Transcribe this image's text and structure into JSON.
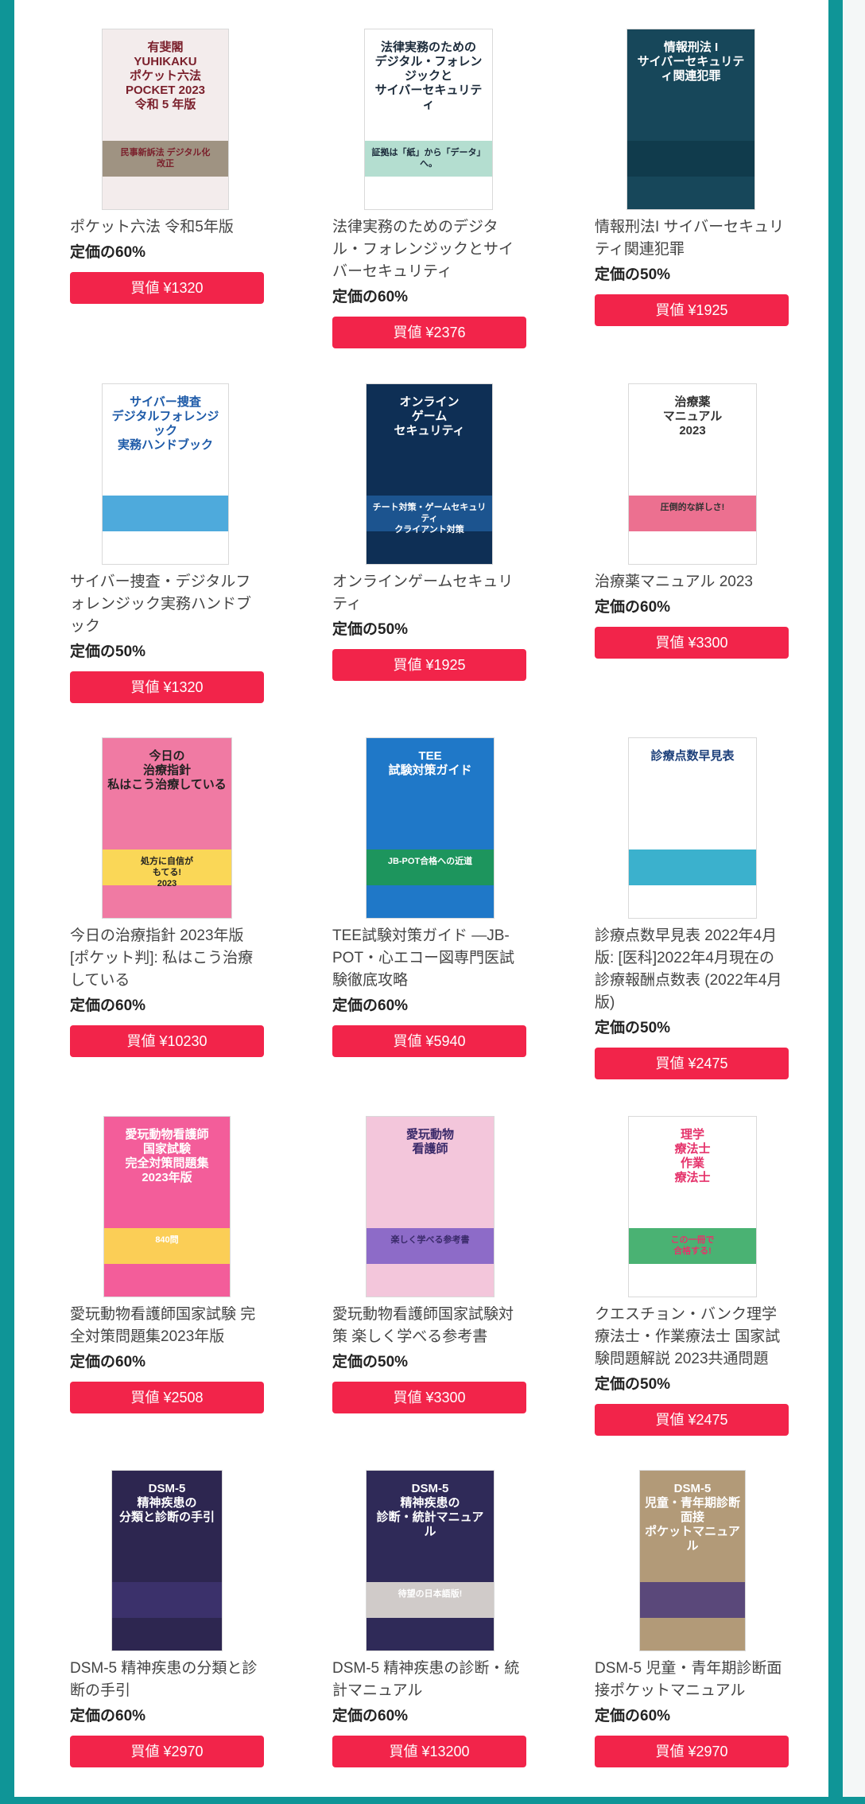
{
  "products": [
    {
      "title": "ポケット六法 令和5年版",
      "rate": "定価の60%",
      "price": "買値 ¥1320",
      "cover": {
        "bg": "#f3ecec",
        "fg": "#7a1f2b",
        "accent": "#8f8470",
        "icon": "book-pocket-roppo-cover-icon",
        "lines": "有斐閣\nYUHIKAKU\nポケット六法\nPOCKET 2023\n令和 5 年版",
        "sub": "民事新訴法 デジタル化\n改正"
      }
    },
    {
      "title": "法律実務のためのデジタル・フォレンジックとサイバーセキュリティ",
      "rate": "定価の60%",
      "price": "買値 ¥2376",
      "cover": {
        "bg": "#ffffff",
        "fg": "#1b2a3a",
        "accent": "#a7d8c8",
        "icon": "book-digital-forensics-cover-icon",
        "lines": "法律実務のための\nデジタル・フォレンジックと\nサイバーセキュリティ",
        "sub": "証拠は「紙」から「データ」へ。"
      }
    },
    {
      "title": "情報刑法I サイバーセキュリティ関連犯罪",
      "rate": "定価の50%",
      "price": "買値 ¥1925",
      "cover": {
        "bg": "#17475a",
        "fg": "#ffffff",
        "accent": "#0f3a4a",
        "icon": "book-joho-keiho-cover-icon",
        "lines": "情報刑法 I\nサイバーセキュリティ関連犯罪",
        "sub": ""
      }
    },
    {
      "title": "サイバー捜査・デジタルフォレンジック実務ハンドブック",
      "rate": "定価の50%",
      "price": "買値 ¥1320",
      "cover": {
        "bg": "#ffffff",
        "fg": "#1d5aa8",
        "accent": "#2f9bd6",
        "icon": "book-cyber-sousa-cover-icon",
        "lines": "サイバー捜査\nデジタルフォレンジック\n実務ハンドブック",
        "sub": ""
      }
    },
    {
      "title": "オンラインゲームセキュリティ",
      "rate": "定価の50%",
      "price": "買値 ¥1925",
      "cover": {
        "bg": "#0e2f55",
        "fg": "#ffffff",
        "accent": "#1f5b9a",
        "icon": "book-online-game-security-cover-icon",
        "lines": "オンライン\nゲーム\nセキュリティ",
        "sub": "チート対策・ゲームセキュリティ\nクライアント対策"
      }
    },
    {
      "title": "治療薬マニュアル 2023",
      "rate": "定価の60%",
      "price": "買値 ¥3300",
      "cover": {
        "bg": "#ffffff",
        "fg": "#333333",
        "accent": "#e9577c",
        "icon": "book-chiryoyaku-cover-icon",
        "lines": "治療薬\nマニュアル\n2023",
        "sub": "圧倒的な詳しさ!"
      }
    },
    {
      "title": "今日の治療指針 2023年版 [ポケット判]: 私はこう治療している",
      "rate": "定価の60%",
      "price": "買値 ¥10230",
      "cover": {
        "bg": "#f07aa3",
        "fg": "#222222",
        "accent": "#fbe74a",
        "icon": "book-kyou-no-chiryou-cover-icon",
        "lines": "今日の\n治療指針\n私はこう治療している",
        "sub": "処方に自信が\nもてる!\n2023"
      }
    },
    {
      "title": "TEE試験対策ガイド —JB-POT・心エコー図専門医試験徹底攻略",
      "rate": "定価の60%",
      "price": "買値 ¥5940",
      "cover": {
        "bg": "#1f78c8",
        "fg": "#ffffff",
        "accent": "#1d9a4a",
        "icon": "book-tee-guide-cover-icon",
        "lines": "TEE\n試験対策ガイド",
        "sub": "JB-POT合格への近道"
      }
    },
    {
      "title": "診療点数早見表 2022年4月版: [医科]2022年4月現在の診療報酬点数表 (2022年4月版)",
      "rate": "定価の50%",
      "price": "買値 ¥2475",
      "cover": {
        "bg": "#ffffff",
        "fg": "#1c3f7a",
        "accent": "#19a3c4",
        "icon": "book-shinryo-tensu-cover-icon",
        "lines": "診療点数早見表",
        "sub": ""
      }
    },
    {
      "title": "愛玩動物看護師国家試験 完全対策問題集2023年版",
      "rate": "定価の60%",
      "price": "買値 ¥2508",
      "cover": {
        "bg": "#f35d9a",
        "fg": "#ffffff",
        "accent": "#fbe24a",
        "icon": "book-aigan-mondaishu-cover-icon",
        "lines": "愛玩動物看護師\n国家試験\n完全対策問題集\n2023年版",
        "sub": "840問"
      }
    },
    {
      "title": "愛玩動物看護師国家試験対策 楽しく学べる参考書",
      "rate": "定価の50%",
      "price": "買値 ¥3300",
      "cover": {
        "bg": "#f3c6db",
        "fg": "#3a2a6a",
        "accent": "#7a5bc4",
        "icon": "book-aigan-sankousho-cover-icon",
        "lines": "愛玩動物\n看護師",
        "sub": "楽しく学べる参考書"
      }
    },
    {
      "title": "クエスチョン・バンク理学療法士・作業療法士 国家試験問題解説 2023共通問題",
      "rate": "定価の50%",
      "price": "買値 ¥2475",
      "cover": {
        "bg": "#ffffff",
        "fg": "#e5336b",
        "accent": "#2aa45a",
        "icon": "book-question-bank-pt-ot-cover-icon",
        "lines": "理学\n療法士\n作業\n療法士",
        "sub": "この一冊で\n合格する!"
      }
    },
    {
      "title": "DSM-5 精神疾患の分類と診断の手引",
      "rate": "定価の60%",
      "price": "買値 ¥2970",
      "cover": {
        "bg": "#2d2650",
        "fg": "#ffffff",
        "accent": "#3e3470",
        "icon": "book-dsm5-tebiki-cover-icon",
        "lines": "DSM-5\n精神疾患の\n分類と診断の手引",
        "sub": ""
      }
    },
    {
      "title": "DSM-5 精神疾患の診断・統計マニュアル",
      "rate": "定価の60%",
      "price": "買値 ¥13200",
      "cover": {
        "bg": "#2f2a58",
        "fg": "#ffffff",
        "accent": "#ece7dd",
        "icon": "book-dsm5-manual-cover-icon",
        "lines": "DSM-5\n精神疾患の\n診断・統計マニュアル",
        "sub": "待望の日本語版!"
      }
    },
    {
      "title": "DSM-5 児童・青年期診断面接ポケットマニュアル",
      "rate": "定価の60%",
      "price": "買値 ¥2970",
      "cover": {
        "bg": "#b29a78",
        "fg": "#ffffff",
        "accent": "#4a3a7a",
        "icon": "book-dsm5-child-cover-icon",
        "lines": "DSM-5\n児童・青年期診断面接\nポケットマニュアル",
        "sub": ""
      }
    }
  ]
}
